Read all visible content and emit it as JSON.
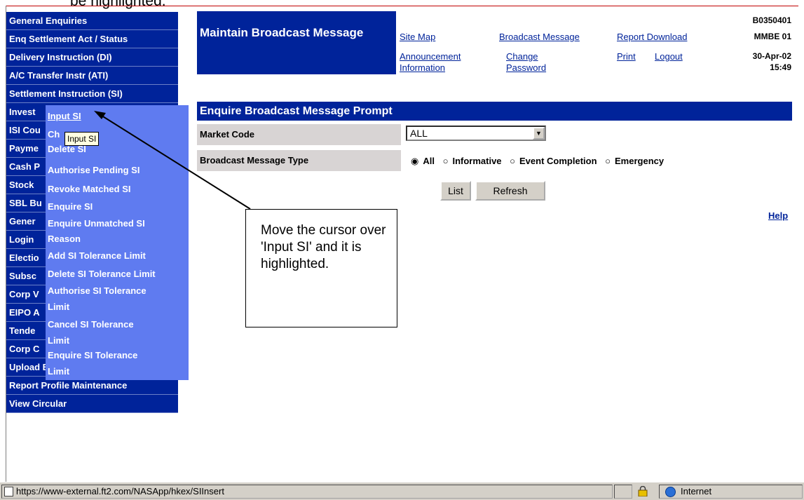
{
  "caption": "be highlighted.",
  "nav": {
    "items": [
      "General Enquiries",
      "Enq Settlement Act / Status",
      "Delivery Instruction (DI)",
      "A/C Transfer Instr (ATI)",
      "Settlement Instruction (SI)",
      "Invest",
      "ISI Cou",
      "Payme",
      "Cash P",
      "Stock",
      "SBL Bu",
      "Gener",
      "Login",
      "Electio",
      "Subsc",
      "Corp V",
      "EIPO A",
      "Tende",
      "Corp C",
      "Upload Batch File",
      "Report Profile Maintenance",
      "View Circular"
    ]
  },
  "header": {
    "title": "Maintain Broadcast Message",
    "links": {
      "site_map": "Site Map",
      "announcement": "Announcement Information",
      "broadcast": "Broadcast Message",
      "change_password": "Change Password",
      "report_download": "Report Download",
      "print": "Print",
      "logout": "Logout"
    },
    "screen_id": "B0350401",
    "function_code": "MMBE 01",
    "date": "30-Apr-02",
    "time": "15:49"
  },
  "prompt": {
    "title": "Enquire Broadcast Message Prompt",
    "market_code_label": "Market Code",
    "market_code_value": "ALL",
    "message_type_label": "Broadcast Message Type",
    "message_types": [
      "All",
      "Informative",
      "Event Completion",
      "Emergency"
    ],
    "selected_type": "All",
    "list_button": "List",
    "refresh_button": "Refresh",
    "help": "Help"
  },
  "submenu": {
    "items": [
      "Input SI",
      "Ch",
      "Delete SI",
      "Authorise Pending SI",
      "Revoke Matched SI",
      "Enquire SI",
      "Enquire Unmatched SI",
      "Reason",
      "Add SI Tolerance Limit",
      "Delete SI Tolerance Limit",
      "Authorise SI Tolerance",
      "Limit",
      "Cancel SI Tolerance",
      "Limit",
      "Enquire SI Tolerance",
      "Limit"
    ],
    "highlighted": "Input SI",
    "tooltip": "Input SI"
  },
  "callout": {
    "text": "Move the cursor over 'Input SI' and it is highlighted."
  },
  "statusbar": {
    "url": "https://www-external.ft2.com/NASApp/hkex/SIInsert",
    "zone": "Internet"
  },
  "colors": {
    "nav_bg": "#00239a",
    "submenu_bg": "#5f7bf0",
    "label_bg": "#d8d4d4"
  }
}
